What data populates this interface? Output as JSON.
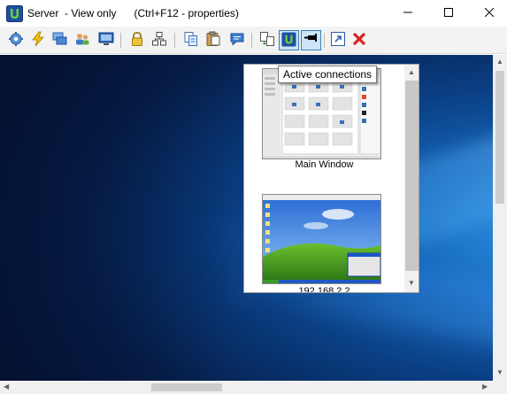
{
  "window": {
    "title": "Server  - View only",
    "shortcut_hint": "(Ctrl+F12 - properties)",
    "icon": "server-app-icon"
  },
  "window_controls": {
    "minimize_icon": "minimize-icon",
    "maximize_icon": "maximize-icon",
    "close_icon": "close-icon"
  },
  "toolbar": {
    "buttons": [
      {
        "icon": "settings-gear-icon"
      },
      {
        "icon": "lightning-icon"
      },
      {
        "icon": "windows-stack-icon"
      },
      {
        "icon": "users-icon"
      },
      {
        "icon": "screen-capture-icon"
      },
      {
        "icon": "lock-icon"
      },
      {
        "icon": "network-icon"
      },
      {
        "icon": "copy-icon"
      },
      {
        "icon": "paste-icon"
      },
      {
        "icon": "chat-icon"
      },
      {
        "icon": "file-transfer-icon"
      },
      {
        "icon": "active-connections-icon",
        "active": true
      },
      {
        "icon": "pin-icon",
        "active": true
      },
      {
        "icon": "external-window-icon"
      },
      {
        "icon": "disconnect-x-icon"
      }
    ]
  },
  "tooltip": {
    "text": "Active connections"
  },
  "connections_panel": {
    "items": [
      {
        "label": "Main Window"
      },
      {
        "label": "192.168.2.2"
      }
    ]
  },
  "colors": {
    "accent": "#3c7fb1",
    "active_button_bg": "#cce4f7",
    "desktop_dark": "#061f4c",
    "desktop_light": "#2a8fe0",
    "close_red": "#e81123"
  }
}
